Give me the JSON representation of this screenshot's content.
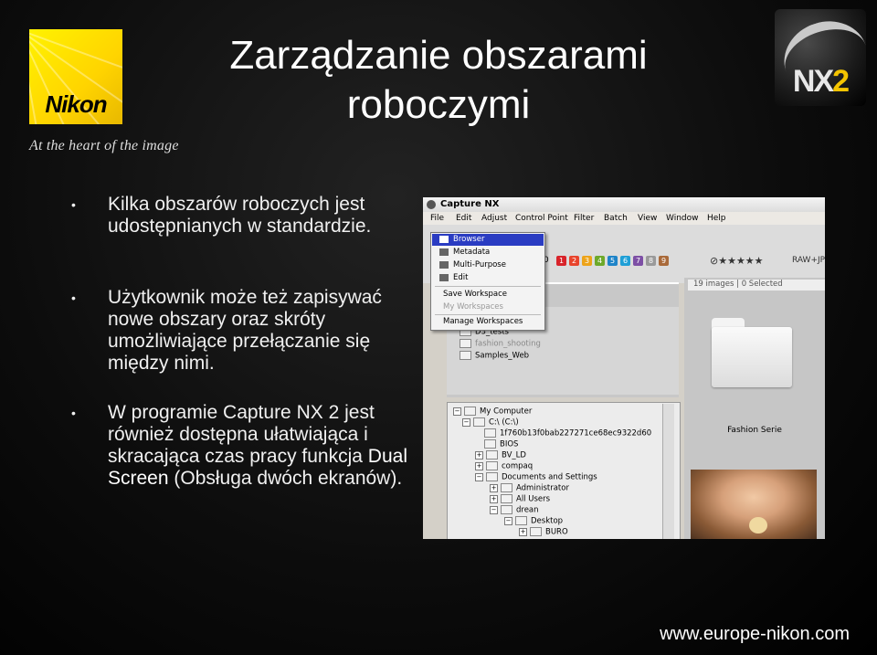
{
  "slide": {
    "title": "Zarządzanie obszarami roboczymi",
    "tagline": "At the heart of the image",
    "brand": "Nikon",
    "nx2_logo": {
      "nx": "NX",
      "two": "2"
    },
    "footer_url": "www.europe-nikon.com",
    "bullets": [
      "Kilka obszarów roboczych jest udostępnianych w standardzie.",
      "Użytkownik może też zapisywać nowe obszary oraz skróty umożliwiające przełączanie się między nimi."
    ],
    "bullet3": {
      "before": "W programie Capture NX 2 jest również dostępna ułatwiająca i skracająca czas pracy funkcja ",
      "emphasis": "Dual Screen",
      "after": " (Obsługa dwóch ekranów)."
    }
  },
  "app": {
    "window_title": "Capture NX",
    "menu": [
      "File",
      "Edit",
      "Adjust",
      "Control Point",
      "Filter",
      "Batch",
      "View",
      "Window",
      "Help"
    ],
    "popup_menu": [
      {
        "label": "Browser",
        "state": "selected"
      },
      {
        "label": "Metadata",
        "state": "normal"
      },
      {
        "label": "Multi-Purpose",
        "state": "normal"
      },
      {
        "label": "Edit",
        "state": "normal"
      },
      {
        "label": "Save Workspace",
        "state": "normal"
      },
      {
        "label": "My Workspaces",
        "state": "disabled"
      },
      {
        "label": "Manage Workspaces",
        "state": "normal"
      }
    ],
    "toolbar": {
      "label_prefix": "0",
      "labels": [
        "1",
        "2",
        "3",
        "4",
        "5",
        "6",
        "7",
        "8",
        "9"
      ],
      "label_colors": [
        "#d8232a",
        "#e8442c",
        "#eda319",
        "#6ea92a",
        "#1f84c8",
        "#1f9fd6",
        "#7d4fa5",
        "#9a9a9a",
        "#a96a3a"
      ],
      "rating": "★★★★★",
      "filter": "RAW+JP"
    },
    "browser_folders": [
      "D3_tests",
      "fashion_shooting",
      "Samples_Web"
    ],
    "image_count": "19 images | 0 Selected",
    "folder_name": "Fashion Serie",
    "tree": [
      "My Computer",
      "C:\\ (C:\\)",
      "1f760b13f0bab227271ce68ec9322d60",
      "BIOS",
      "BV_LD",
      "compaq",
      "Documents and Settings",
      "Administrator",
      "All Users",
      "drean",
      "Desktop",
      "BURO"
    ]
  }
}
